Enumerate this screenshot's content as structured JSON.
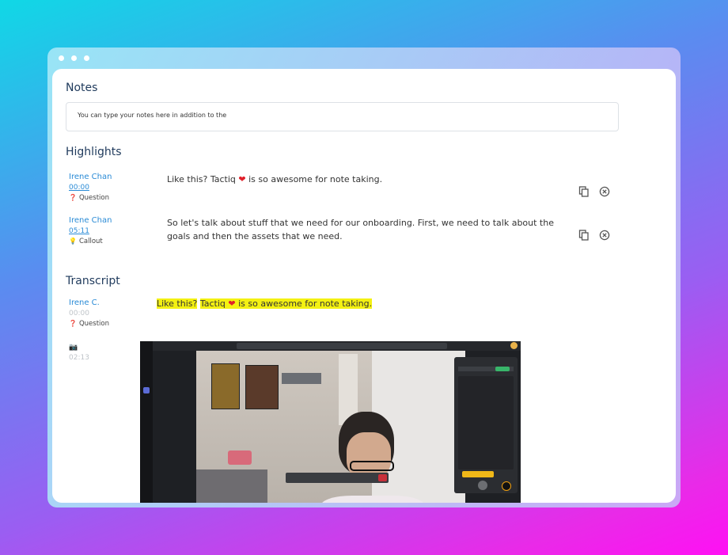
{
  "window": {
    "dots": 3
  },
  "notes": {
    "heading": "Notes",
    "placeholder": "You can type your notes here in addition to the"
  },
  "highlights": {
    "heading": "Highlights",
    "items": [
      {
        "speaker": "Irene Chan",
        "time": "00:00",
        "tag_icon": "question-mark-icon",
        "tag": "Question",
        "text_before": "Like this? Tactiq ",
        "text_after": " is so awesome for note taking.",
        "has_heart": true
      },
      {
        "speaker": "Irene Chan",
        "time": "05:11",
        "tag_icon": "lightbulb-icon",
        "tag": "Callout",
        "text_before": "So let's talk about stuff that we need for our onboarding. First, we need to talk about the goals and then the assets that we need.",
        "text_after": "",
        "has_heart": false
      }
    ]
  },
  "transcript": {
    "heading": "Transcript",
    "entries": [
      {
        "speaker": "Irene C.",
        "time": "00:00",
        "tag_icon": "question-mark-icon",
        "tag": "Question",
        "part1": "Like this?",
        "part2": "Tactiq",
        "part3": "is so awesome for note taking."
      },
      {
        "speaker_icon": "camera-icon",
        "time": "02:13",
        "content": "screenshot"
      }
    ]
  },
  "colors": {
    "accent": "#2a8bd6",
    "highlight": "#f4f112",
    "heading": "#1f3a5c",
    "heart": "#e0202a"
  }
}
